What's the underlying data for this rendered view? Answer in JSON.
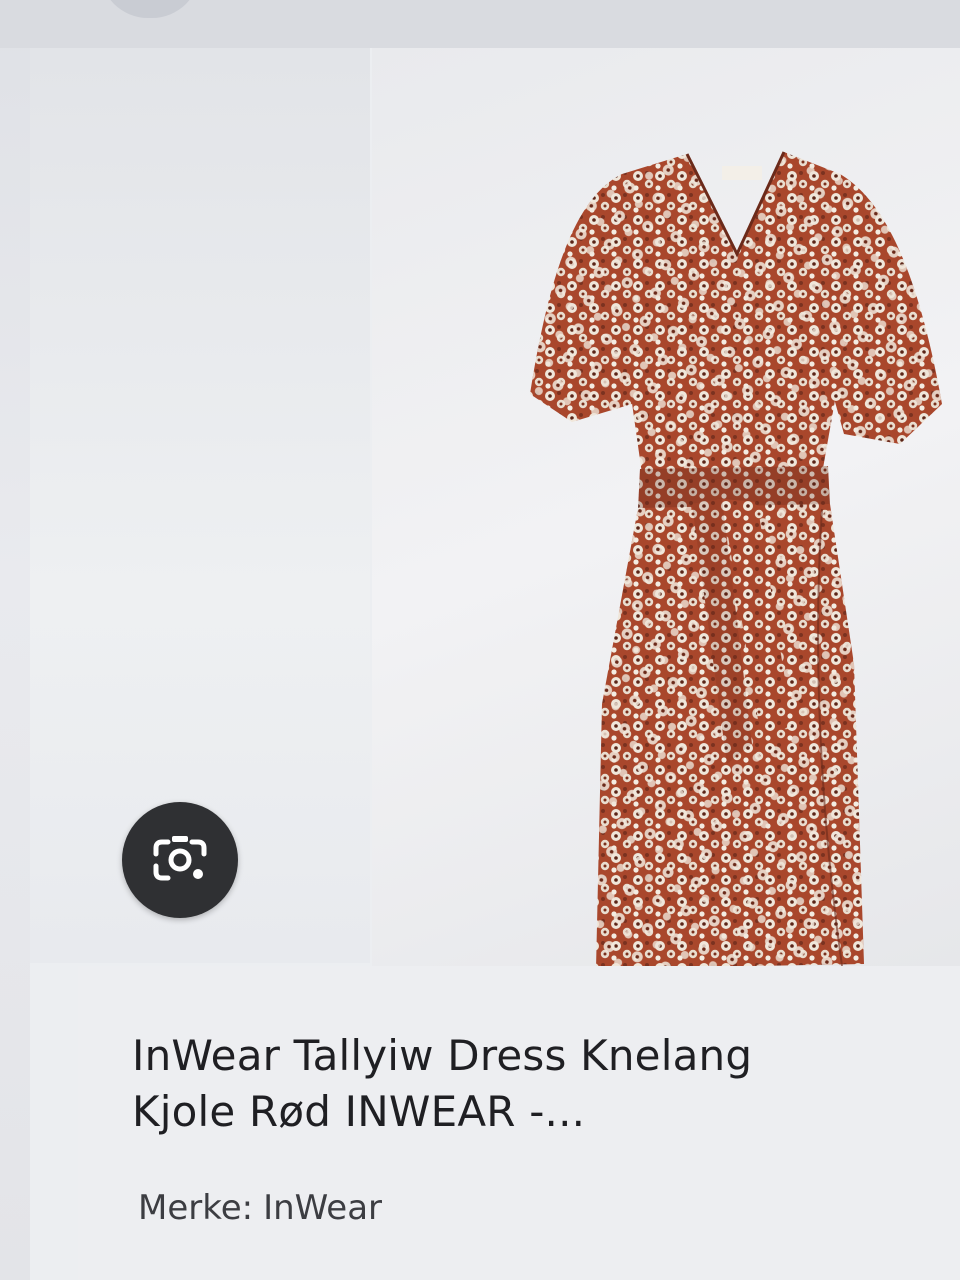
{
  "result": {
    "title_line1": "InWear Tallyiw Dress Knelang",
    "title_line2": "Kjole Rød INWEAR -...",
    "brand_label": "Merke:",
    "brand_value": "InWear"
  },
  "lens_button": {
    "icon": "google-lens-icon",
    "aria_label": "Google Lens"
  },
  "product_image": {
    "subject": "floral-wrap-dress",
    "colors": {
      "base": "#a9472c",
      "flower": "#efe6da",
      "dark": "#5b2417"
    }
  },
  "colors": {
    "lens_bg": "#2f3033",
    "text_primary": "#1f1f23",
    "text_secondary": "#3c3d42"
  }
}
